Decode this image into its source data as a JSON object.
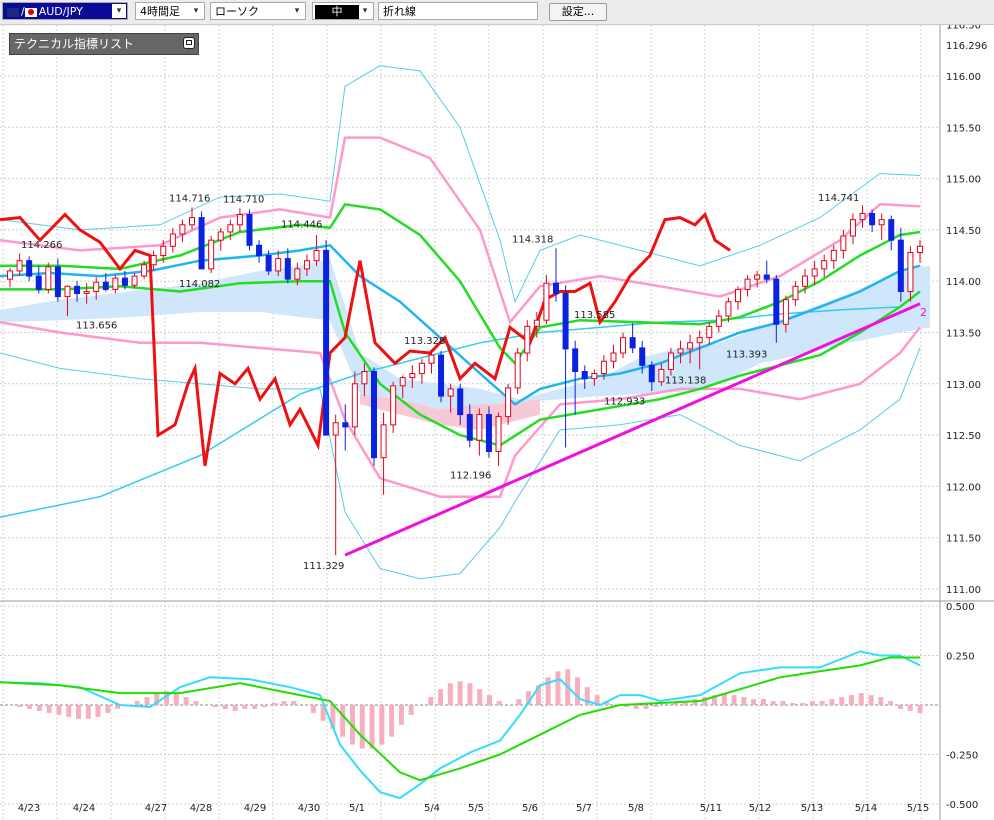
{
  "toolbar": {
    "symbol": "AUD/JPY",
    "timeframe": "4時間足",
    "chart_type": "ローソク",
    "color_selector": "中",
    "line_type": "折れ線",
    "settings_label": "設定..."
  },
  "tech_panel": {
    "title": "テクニカル指標リスト"
  },
  "colors": {
    "candle_up": "#e8001c",
    "candle_down": "#0a23e0",
    "macd_line": "#33dcff",
    "signal_line": "#22dd00",
    "histogram": "#f6b0bd",
    "trendline": "#ee11dd",
    "osc_red": "#ee1111",
    "bollinger_outer": "#55ccee",
    "bollinger_inner": "#ff99cc"
  },
  "chart_data": {
    "type": "candlestick",
    "price_axis": {
      "ticks": [
        "116.50",
        "116.00",
        "115.50",
        "115.00",
        "114.50",
        "114.00",
        "113.50",
        "113.00",
        "112.50",
        "112.00",
        "111.50",
        "111.00"
      ],
      "ylim": [
        111.0,
        116.5
      ],
      "current_price": "116.296"
    },
    "macd_axis": {
      "ticks": [
        "0.500",
        "0.250",
        "-0.250",
        "-0.500"
      ],
      "ylim": [
        -0.5,
        0.5
      ]
    },
    "x_labels": [
      "4/23",
      "4/24",
      "4/27",
      "4/28",
      "4/29",
      "4/30",
      "5/1",
      "5/4",
      "5/5",
      "5/6",
      "5/7",
      "5/8",
      "5/11",
      "5/12",
      "5/13",
      "5/14",
      "5/15"
    ],
    "annotations": [
      {
        "text": "114.266",
        "x": "4/23",
        "y": 114.266
      },
      {
        "text": "113.656",
        "x": "4/24",
        "y": 113.656
      },
      {
        "text": "114.716",
        "x": "4/28",
        "y": 114.716
      },
      {
        "text": "114.082",
        "x": "4/28",
        "y": 114.082
      },
      {
        "text": "114.710",
        "x": "4/29",
        "y": 114.71
      },
      {
        "text": "114.446",
        "x": "4/30",
        "y": 114.446
      },
      {
        "text": "111.329",
        "x": "5/1",
        "y": 111.329
      },
      {
        "text": "113.328",
        "x": "5/4",
        "y": 113.328
      },
      {
        "text": "112.196",
        "x": "5/5",
        "y": 112.196
      },
      {
        "text": "114.318",
        "x": "5/6",
        "y": 114.318
      },
      {
        "text": "113.585",
        "x": "5/7",
        "y": 113.585
      },
      {
        "text": "112.933",
        "x": "5/8",
        "y": 112.933
      },
      {
        "text": "113.138",
        "x": "5/8",
        "y": 113.138
      },
      {
        "text": "113.393",
        "x": "5/12",
        "y": 113.393
      },
      {
        "text": "114.741",
        "x": "5/14",
        "y": 114.741
      }
    ],
    "trendline": {
      "from": {
        "x": "5/1",
        "y": 111.33
      },
      "to": {
        "x": "5/15",
        "y": 113.78
      },
      "label": "2"
    },
    "candles": [
      [
        114.02,
        114.13,
        113.94,
        114.1
      ],
      [
        114.1,
        114.27,
        114.05,
        114.2
      ],
      [
        114.2,
        114.24,
        114.0,
        114.05
      ],
      [
        114.05,
        114.15,
        113.88,
        113.92
      ],
      [
        113.92,
        114.18,
        113.88,
        114.14
      ],
      [
        114.14,
        114.22,
        113.8,
        113.85
      ],
      [
        113.85,
        113.96,
        113.66,
        113.95
      ],
      [
        113.95,
        114.0,
        113.8,
        113.88
      ],
      [
        113.88,
        113.98,
        113.78,
        113.9
      ],
      [
        113.9,
        114.04,
        113.82,
        113.99
      ],
      [
        113.99,
        114.08,
        113.9,
        113.92
      ],
      [
        113.92,
        114.06,
        113.88,
        114.03
      ],
      [
        114.03,
        114.1,
        113.92,
        113.96
      ],
      [
        113.96,
        114.08,
        113.93,
        114.05
      ],
      [
        114.05,
        114.2,
        114.02,
        114.16
      ],
      [
        114.16,
        114.3,
        114.1,
        114.25
      ],
      [
        114.25,
        114.4,
        114.18,
        114.34
      ],
      [
        114.34,
        114.52,
        114.28,
        114.46
      ],
      [
        114.46,
        114.6,
        114.38,
        114.55
      ],
      [
        114.55,
        114.72,
        114.5,
        114.62
      ],
      [
        114.62,
        114.68,
        114.22,
        114.12
      ],
      [
        114.12,
        114.44,
        114.08,
        114.4
      ],
      [
        114.4,
        114.52,
        114.3,
        114.48
      ],
      [
        114.48,
        114.6,
        114.4,
        114.55
      ],
      [
        114.55,
        114.71,
        114.48,
        114.65
      ],
      [
        114.65,
        114.7,
        114.3,
        114.35
      ],
      [
        114.35,
        114.4,
        114.18,
        114.25
      ],
      [
        114.25,
        114.3,
        114.06,
        114.1
      ],
      [
        114.1,
        114.3,
        114.05,
        114.22
      ],
      [
        114.22,
        114.32,
        113.98,
        114.02
      ],
      [
        114.02,
        114.18,
        113.96,
        114.12
      ],
      [
        114.12,
        114.26,
        114.05,
        114.2
      ],
      [
        114.2,
        114.45,
        114.15,
        114.3
      ],
      [
        114.3,
        114.4,
        112.6,
        112.5
      ],
      [
        112.5,
        112.7,
        111.33,
        112.62
      ],
      [
        112.62,
        112.8,
        112.35,
        112.58
      ],
      [
        112.58,
        113.12,
        112.5,
        113.0
      ],
      [
        113.0,
        113.2,
        112.88,
        113.12
      ],
      [
        113.12,
        113.16,
        112.2,
        112.28
      ],
      [
        112.28,
        112.72,
        111.92,
        112.6
      ],
      [
        112.6,
        113.02,
        112.52,
        112.98
      ],
      [
        112.98,
        113.08,
        112.86,
        113.06
      ],
      [
        113.06,
        113.18,
        112.96,
        113.1
      ],
      [
        113.1,
        113.24,
        113.0,
        113.2
      ],
      [
        113.2,
        113.33,
        113.1,
        113.28
      ],
      [
        113.28,
        113.32,
        112.82,
        112.88
      ],
      [
        112.88,
        113.0,
        112.72,
        112.95
      ],
      [
        112.95,
        113.0,
        112.6,
        112.7
      ],
      [
        112.7,
        112.8,
        112.38,
        112.45
      ],
      [
        112.45,
        112.76,
        112.3,
        112.7
      ],
      [
        112.7,
        112.78,
        112.28,
        112.34
      ],
      [
        112.34,
        112.72,
        112.2,
        112.68
      ],
      [
        112.68,
        113.0,
        112.6,
        112.96
      ],
      [
        112.96,
        113.35,
        112.9,
        113.3
      ],
      [
        113.3,
        113.62,
        113.22,
        113.56
      ],
      [
        113.56,
        113.7,
        113.45,
        113.62
      ],
      [
        113.62,
        114.06,
        113.58,
        113.98
      ],
      [
        113.98,
        114.32,
        113.8,
        113.88
      ],
      [
        113.88,
        113.96,
        112.38,
        113.34
      ],
      [
        113.34,
        113.42,
        112.7,
        113.12
      ],
      [
        113.12,
        113.18,
        112.95,
        113.05
      ],
      [
        113.05,
        113.14,
        112.98,
        113.1
      ],
      [
        113.1,
        113.28,
        113.04,
        113.22
      ],
      [
        113.22,
        113.38,
        113.15,
        113.3
      ],
      [
        113.3,
        113.5,
        113.25,
        113.45
      ],
      [
        113.45,
        113.59,
        113.3,
        113.35
      ],
      [
        113.35,
        113.42,
        113.1,
        113.18
      ],
      [
        113.18,
        113.22,
        112.93,
        113.02
      ],
      [
        113.02,
        113.2,
        112.98,
        113.14
      ],
      [
        113.14,
        113.35,
        113.08,
        113.3
      ],
      [
        113.3,
        113.42,
        113.2,
        113.34
      ],
      [
        113.34,
        113.48,
        113.2,
        113.4
      ],
      [
        113.4,
        113.52,
        113.14,
        113.45
      ],
      [
        113.45,
        113.6,
        113.38,
        113.56
      ],
      [
        113.56,
        113.72,
        113.5,
        113.66
      ],
      [
        113.66,
        113.84,
        113.6,
        113.8
      ],
      [
        113.8,
        113.95,
        113.72,
        113.92
      ],
      [
        113.92,
        114.06,
        113.85,
        114.02
      ],
      [
        114.02,
        114.1,
        113.94,
        114.06
      ],
      [
        114.06,
        114.2,
        113.98,
        114.02
      ],
      [
        114.02,
        114.06,
        113.4,
        113.58
      ],
      [
        113.58,
        113.86,
        113.5,
        113.82
      ],
      [
        113.82,
        114.0,
        113.76,
        113.95
      ],
      [
        113.95,
        114.12,
        113.88,
        114.05
      ],
      [
        114.05,
        114.2,
        113.96,
        114.12
      ],
      [
        114.12,
        114.26,
        114.04,
        114.2
      ],
      [
        114.2,
        114.35,
        114.12,
        114.3
      ],
      [
        114.3,
        114.5,
        114.22,
        114.44
      ],
      [
        114.44,
        114.66,
        114.36,
        114.6
      ],
      [
        114.6,
        114.74,
        114.52,
        114.66
      ],
      [
        114.66,
        114.7,
        114.48,
        114.55
      ],
      [
        114.55,
        114.66,
        114.4,
        114.6
      ],
      [
        114.6,
        114.64,
        114.3,
        114.4
      ],
      [
        114.4,
        114.52,
        113.8,
        113.9
      ],
      [
        113.9,
        114.34,
        113.8,
        114.28
      ],
      [
        114.28,
        114.4,
        114.18,
        114.34
      ]
    ]
  }
}
